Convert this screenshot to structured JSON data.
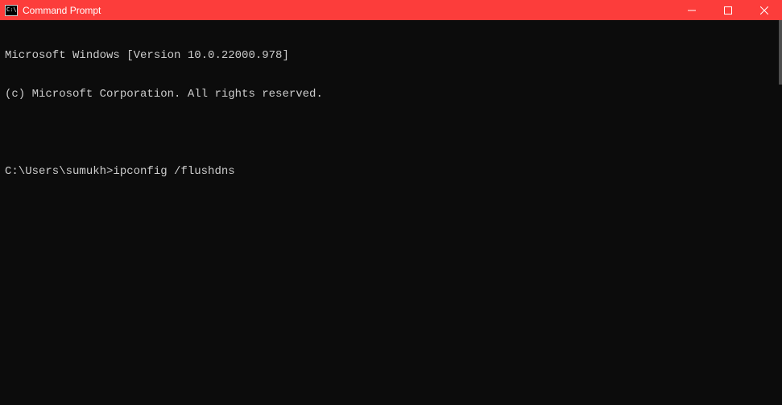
{
  "titlebar": {
    "title": "Command Prompt",
    "icon_text": "C:\\"
  },
  "terminal": {
    "header_line1": "Microsoft Windows [Version 10.0.22000.978]",
    "header_line2": "(c) Microsoft Corporation. All rights reserved.",
    "prompt": "C:\\Users\\sumukh>",
    "command": "ipconfig /flushdns"
  }
}
